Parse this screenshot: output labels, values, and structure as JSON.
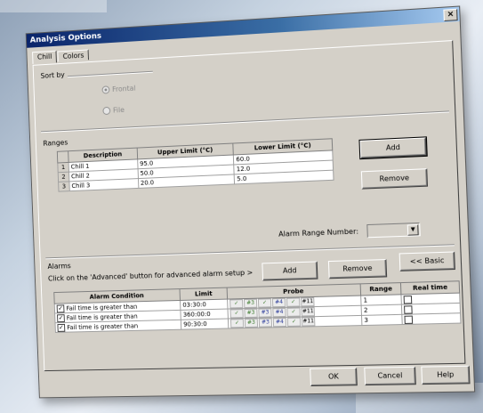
{
  "window": {
    "title": "Analysis Options",
    "close_glyph": "×"
  },
  "tabs": [
    {
      "label": "Chill"
    },
    {
      "label": "Colors"
    }
  ],
  "sort": {
    "label": "Sort by",
    "options": [
      {
        "label": "Frontal",
        "selected": true
      },
      {
        "label": "File",
        "selected": false
      }
    ]
  },
  "ranges": {
    "label": "Ranges",
    "headers": [
      "Description",
      "Upper Limit (°C)",
      "Lower Limit (°C)"
    ],
    "rows": [
      {
        "n": "1",
        "description": "Chill 1",
        "upper": "95.0",
        "lower": "60.0"
      },
      {
        "n": "2",
        "description": "Chill 2",
        "upper": "50.0",
        "lower": "12.0"
      },
      {
        "n": "3",
        "description": "Chill 3",
        "upper": "20.0",
        "lower": "5.0"
      }
    ],
    "add_label": "Add",
    "remove_label": "Remove",
    "alarm_range_number_label": "Alarm Range Number:"
  },
  "alarms": {
    "label": "Alarms",
    "hint": "Click on the 'Advanced' button for advanced alarm setup >",
    "add_label": "Add",
    "remove_label": "Remove",
    "basic_label": "<< Basic",
    "headers": [
      "Alarm Condition",
      "Limit",
      "Probe",
      "Range",
      "Real time"
    ],
    "rows": [
      {
        "condition": "Fail time is greater than",
        "limit": "03:30:0",
        "range": "1",
        "probes": [
          "✓",
          "#3",
          "✓",
          "#4",
          "✓",
          "#11"
        ]
      },
      {
        "condition": "Fail time is greater than",
        "limit": "360:00:0",
        "range": "2",
        "probes": [
          "✓",
          "#3",
          "#3",
          "#4",
          "✓",
          "#11"
        ]
      },
      {
        "condition": "Fail time is greater than",
        "limit": "90:30:0",
        "range": "3",
        "probes": [
          "✓",
          "#3",
          "#3",
          "#4",
          "✓",
          "#11"
        ]
      }
    ]
  },
  "footer": {
    "ok_label": "OK",
    "cancel_label": "Cancel",
    "help_label": "Help"
  }
}
